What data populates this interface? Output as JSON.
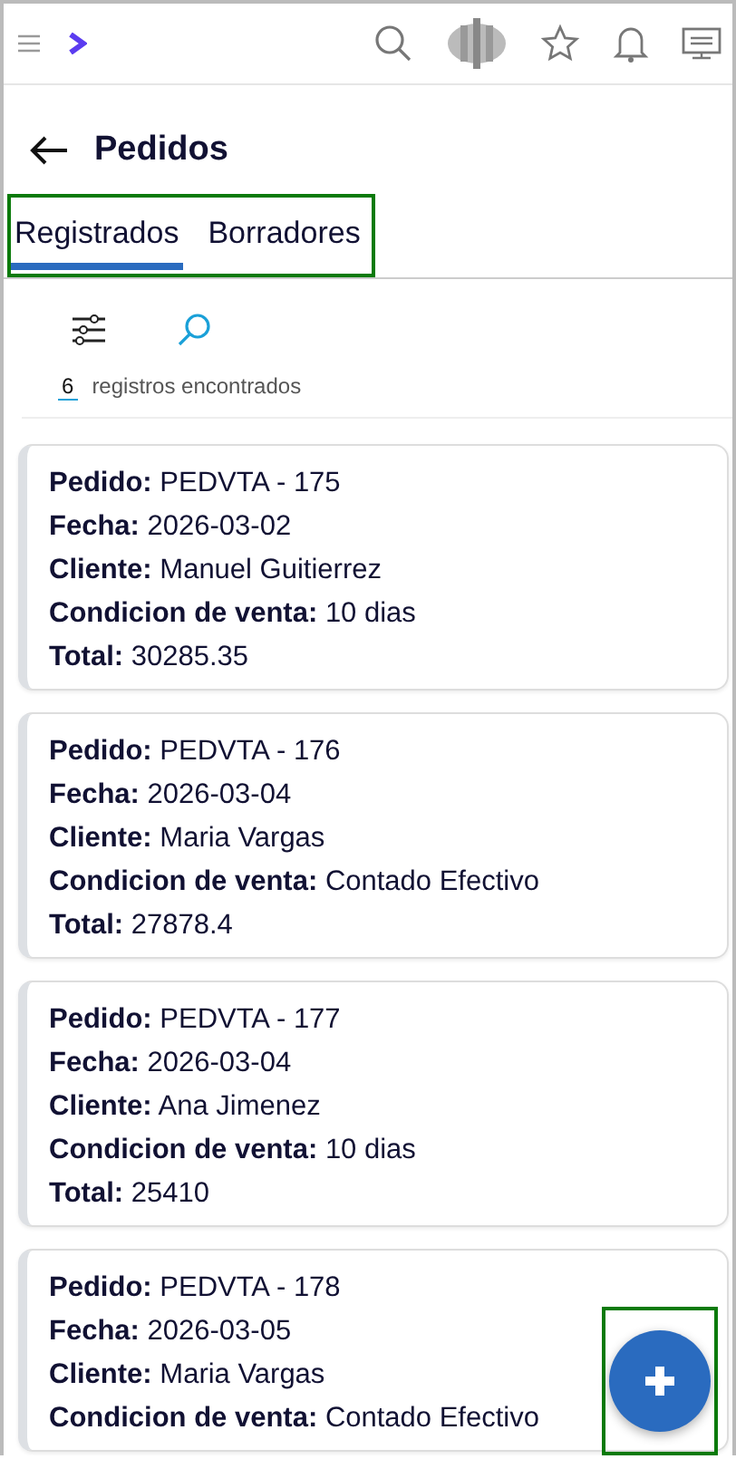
{
  "header": {
    "title": "Pedidos"
  },
  "tabs": {
    "highlighted": true,
    "items": [
      {
        "label": "Registrados",
        "selected": true
      },
      {
        "label": "Borradores",
        "selected": false
      }
    ]
  },
  "results": {
    "count": "6",
    "label": "registros encontrados"
  },
  "orders": [
    {
      "fields": [
        {
          "label": "Pedido:",
          "value": "PEDVTA - 175"
        },
        {
          "label": "Fecha:",
          "value": "2026-03-02"
        },
        {
          "label": "Cliente:",
          "value": "Manuel Guitierrez"
        },
        {
          "label": "Condicion de venta:",
          "value": "10 dias"
        },
        {
          "label": "Total:",
          "value": "30285.35"
        }
      ]
    },
    {
      "fields": [
        {
          "label": "Pedido:",
          "value": "PEDVTA - 176"
        },
        {
          "label": "Fecha:",
          "value": "2026-03-04"
        },
        {
          "label": "Cliente:",
          "value": "Maria Vargas"
        },
        {
          "label": "Condicion de venta:",
          "value": "Contado Efectivo"
        },
        {
          "label": "Total:",
          "value": "27878.4"
        }
      ]
    },
    {
      "fields": [
        {
          "label": "Pedido:",
          "value": "PEDVTA - 177"
        },
        {
          "label": "Fecha:",
          "value": "2026-03-04"
        },
        {
          "label": "Cliente:",
          "value": "Ana Jimenez"
        },
        {
          "label": "Condicion de venta:",
          "value": "10 dias"
        },
        {
          "label": "Total:",
          "value": "25410"
        }
      ]
    },
    {
      "fields": [
        {
          "label": "Pedido:",
          "value": "PEDVTA - 178"
        },
        {
          "label": "Fecha:",
          "value": "2026-03-05"
        },
        {
          "label": "Cliente:",
          "value": "Maria Vargas"
        },
        {
          "label": "Condicion de venta:",
          "value": "Contado Efectivo"
        }
      ]
    }
  ],
  "fab": {
    "highlighted": true
  }
}
